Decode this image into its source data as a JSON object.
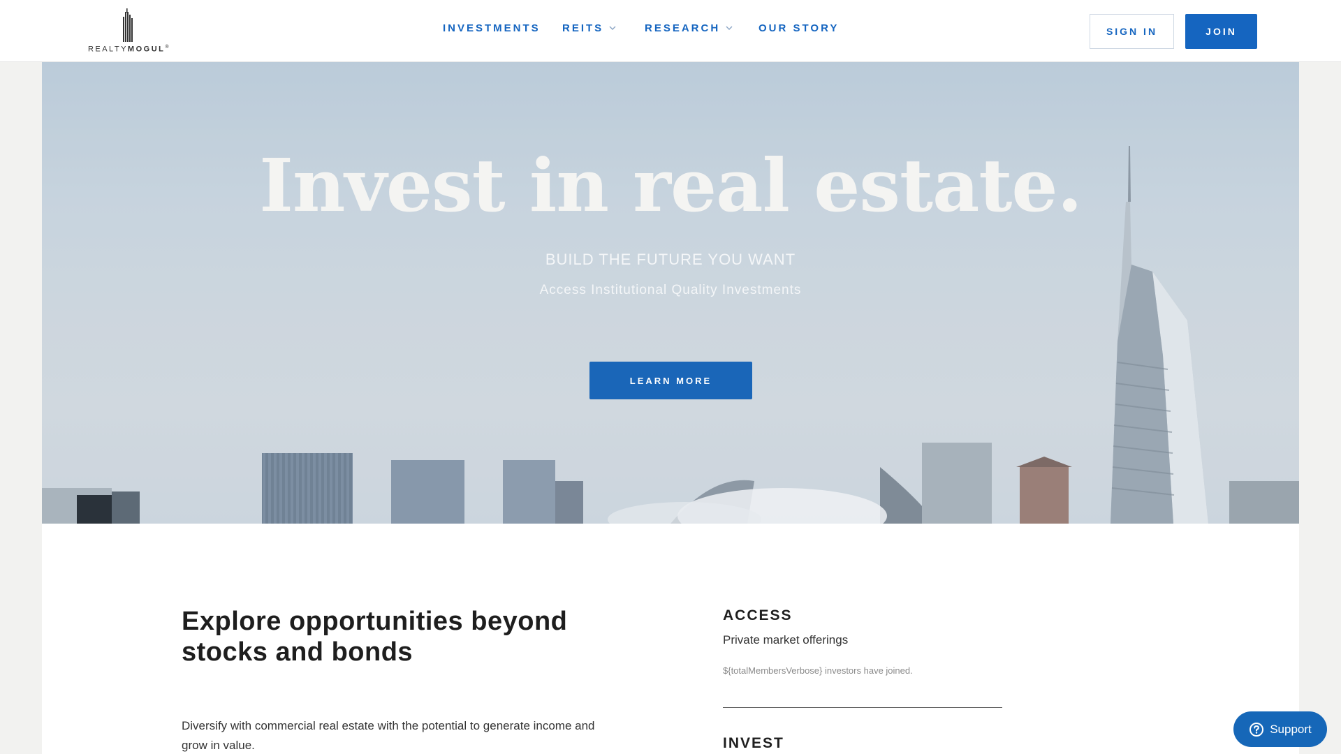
{
  "header": {
    "logo_prefix": "REALTY",
    "logo_suffix": "MOGUL",
    "logo_mark": "®",
    "nav": [
      {
        "label": "INVESTMENTS",
        "has_dropdown": false
      },
      {
        "label": "REITS",
        "has_dropdown": true
      },
      {
        "label": "RESEARCH",
        "has_dropdown": true
      },
      {
        "label": "OUR STORY",
        "has_dropdown": false
      }
    ],
    "sign_in_label": "SIGN IN",
    "join_label": "JOIN"
  },
  "hero": {
    "title": "Invest in real estate.",
    "subtitle": "BUILD THE FUTURE YOU WANT",
    "tagline": "Access Institutional Quality Investments",
    "cta_label": "LEARN MORE"
  },
  "main": {
    "heading": "Explore opportunities beyond stocks and bonds",
    "description": "Diversify with commercial real estate with the potential to generate income and grow in value.",
    "features": [
      {
        "title": "ACCESS",
        "subtitle": "Private market offerings",
        "note": "${totalMembersVerbose} investors have joined."
      },
      {
        "title": "INVEST"
      }
    ]
  },
  "support": {
    "label": "Support",
    "icon": "question-circle-icon"
  },
  "colors": {
    "accent": "#1565c0",
    "button": "#1a66b8",
    "header_bg": "#ffffff",
    "page_bg": "#f2f2f0"
  }
}
